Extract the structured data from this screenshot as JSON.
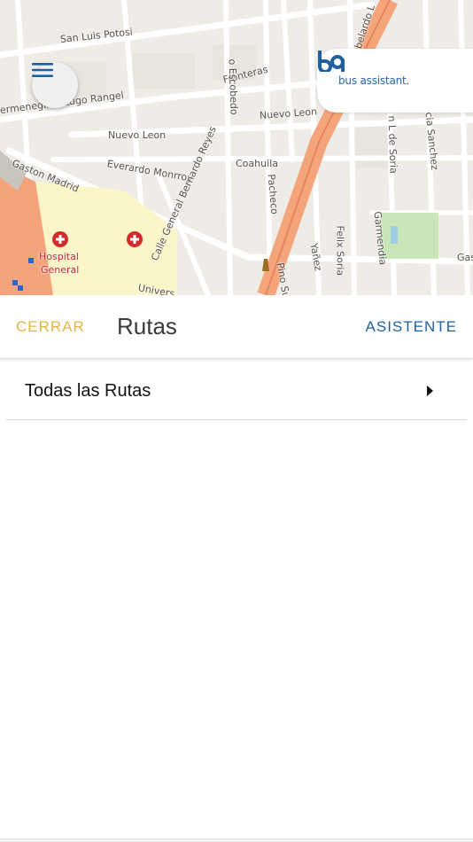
{
  "map": {
    "labels": {
      "san_luis_potosi": "San Luis Potosi",
      "hermenegildo": "ermenegildo Lugo Rangel",
      "fronteras": "Fronteras",
      "nuevo_leon_1": "Nuevo Leon",
      "nuevo_leon_2": "Nuevo Leon",
      "everardo": "Everardo Monrroy",
      "coahuila": "Coahuila",
      "gaston_madrid": "Gaston Madrid",
      "bernardo_reyes": "Calle General Bernardo Reyes",
      "escobedo": "o Escobedo",
      "pacheco": "Pacheco",
      "abelardo": "belardo L",
      "soria": "n L de Soria",
      "sanchez": "cia Sanchez",
      "garmendia": "Garmendia",
      "felix_soria": "Felix Soria",
      "yanez": "Yañez",
      "pino_su": "Pino Su",
      "gas": "Gas",
      "universidad": "Univers",
      "hospital_line1": "Hospital",
      "hospital_line2": "General"
    }
  },
  "menu": {
    "icon": "hamburger-menu-icon"
  },
  "brand": {
    "logo_icon": "bus-assistant-logo-icon",
    "text": "bus assistant.",
    "color": "#2b66a8"
  },
  "header": {
    "close_label": "CERRAR",
    "title": "Rutas",
    "assistant_label": "ASISTENTE",
    "close_color": "#e3b547",
    "assistant_color": "#1f5fa0"
  },
  "routes": {
    "items": [
      {
        "label": "Todas las Rutas",
        "icon": "caret-right-icon"
      }
    ]
  }
}
